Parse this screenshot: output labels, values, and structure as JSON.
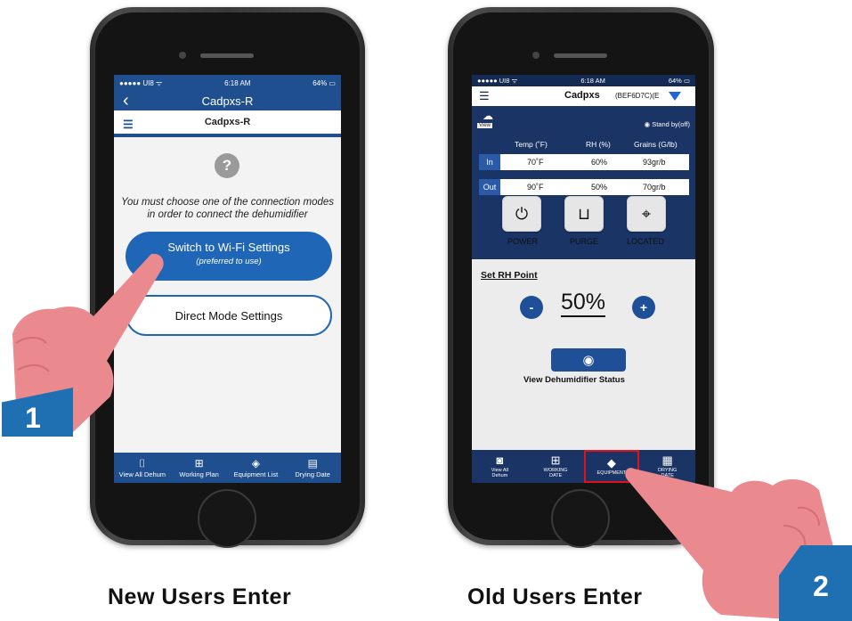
{
  "left_phone": {
    "status": {
      "carrier": "●●●●● UI8 ᯤ",
      "time": "6:18 AM",
      "battery": "64% ▭"
    },
    "nav_title": "Cadpxs-R",
    "sub_title": "Cadpxs-R",
    "message": "You must choose one of the connection modes in order to connect the dehumidifier",
    "wifi_button": {
      "label": "Switch to Wi-Fi Settings",
      "sublabel": "(preferred to use)"
    },
    "direct_button": "Direct Mode Settings",
    "tabs": [
      {
        "label": "View All Dehum",
        "icon": "camera-icon"
      },
      {
        "label": "Working Plan",
        "icon": "plan-icon"
      },
      {
        "label": "Equipment List",
        "icon": "equipment-icon"
      },
      {
        "label": "Drying Date",
        "icon": "clipboard-icon"
      }
    ]
  },
  "right_phone": {
    "status": {
      "carrier": "●●●●● UI8 ᯤ",
      "time": "6:18 AM",
      "battery": "64% ▭"
    },
    "title": "Cadpxs",
    "device_id": "(BEF6D7C)(E",
    "view_label": "View",
    "standby": "◉  Stand by(off)",
    "headers": {
      "temp": "Temp (˚F)",
      "rh": "RH (%)",
      "grains": "Grains (G/lb)"
    },
    "rows": [
      {
        "label": "In",
        "temp": "70˚F",
        "rh": "60%",
        "grains": "93gr/b"
      },
      {
        "label": "Out",
        "temp": "90˚F",
        "rh": "50%",
        "grains": "70gr/b"
      }
    ],
    "controls": [
      {
        "label": "POWER",
        "icon": "power-icon"
      },
      {
        "label": "PURGE",
        "icon": "purge-icon"
      },
      {
        "label": "LOCATED",
        "icon": "location-icon"
      }
    ],
    "set_rh_label": "Set RH Point",
    "minus": "-",
    "plus": "+",
    "rh_value": "50%",
    "view_status_label": "View Dehumidifier Status",
    "tabs": [
      {
        "label": "View All\nDehum",
        "icon": "camera-icon"
      },
      {
        "label": "WORKING\nDATE",
        "icon": "plan-icon"
      },
      {
        "label": "EQUIPMENT",
        "icon": "cube-icon",
        "highlighted": true
      },
      {
        "label": "DRYING\nDATE",
        "icon": "clipboard-icon"
      }
    ]
  },
  "badges": {
    "one": "1",
    "two": "2"
  },
  "captions": {
    "left": "New Users Enter",
    "right": "Old Users Enter"
  },
  "colors": {
    "primary_blue": "#1f4f8f",
    "dark_navy": "#1a3466",
    "highlight_red": "#e0131d",
    "hand_pink": "#ea8a8e",
    "badge_blue": "#1f6fb3"
  }
}
